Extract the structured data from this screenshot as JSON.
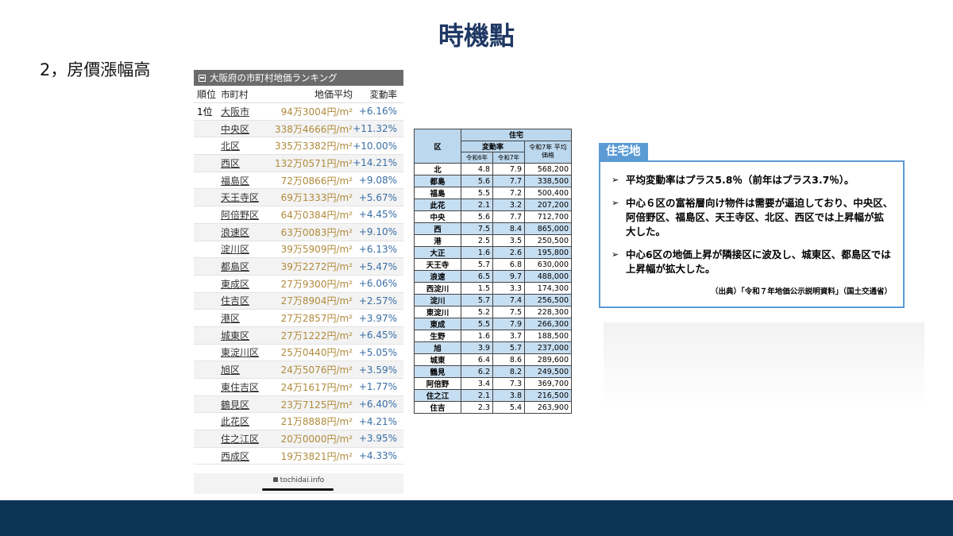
{
  "slide": {
    "title": "時機點",
    "point": "2，房價漲幅高"
  },
  "ranking": {
    "header": "大阪府の市町村地価ランキング",
    "columns": {
      "rank": "順位",
      "city": "市町村",
      "price": "地価平均",
      "change": "変動率"
    },
    "rows": [
      {
        "rank": "1位",
        "city": "大阪市",
        "price": "94万3004円/m²",
        "change": "+6.16%"
      },
      {
        "rank": "",
        "city": "中央区",
        "price": "338万4666円/m²",
        "change": "+11.32%"
      },
      {
        "rank": "",
        "city": "北区",
        "price": "335万3382円/m²",
        "change": "+10.00%"
      },
      {
        "rank": "",
        "city": "西区",
        "price": "132万0571円/m²",
        "change": "+14.21%"
      },
      {
        "rank": "",
        "city": "福島区",
        "price": "72万0866円/m²",
        "change": "+9.08%"
      },
      {
        "rank": "",
        "city": "天王寺区",
        "price": "69万1333円/m²",
        "change": "+5.67%"
      },
      {
        "rank": "",
        "city": "阿倍野区",
        "price": "64万0384円/m²",
        "change": "+4.45%"
      },
      {
        "rank": "",
        "city": "浪速区",
        "price": "63万0083円/m²",
        "change": "+9.10%"
      },
      {
        "rank": "",
        "city": "淀川区",
        "price": "39万5909円/m²",
        "change": "+6.13%"
      },
      {
        "rank": "",
        "city": "都島区",
        "price": "39万2272円/m²",
        "change": "+5.47%"
      },
      {
        "rank": "",
        "city": "東成区",
        "price": "27万9300円/m²",
        "change": "+6.06%"
      },
      {
        "rank": "",
        "city": "住吉区",
        "price": "27万8904円/m²",
        "change": "+2.57%"
      },
      {
        "rank": "",
        "city": "港区",
        "price": "27万2857円/m²",
        "change": "+3.97%"
      },
      {
        "rank": "",
        "city": "城東区",
        "price": "27万1222円/m²",
        "change": "+6.45%"
      },
      {
        "rank": "",
        "city": "東淀川区",
        "price": "25万0440円/m²",
        "change": "+5.05%"
      },
      {
        "rank": "",
        "city": "旭区",
        "price": "24万5076円/m²",
        "change": "+3.59%"
      },
      {
        "rank": "",
        "city": "東住吉区",
        "price": "24万1617円/m²",
        "change": "+1.77%"
      },
      {
        "rank": "",
        "city": "鶴見区",
        "price": "23万7125円/m²",
        "change": "+6.40%"
      },
      {
        "rank": "",
        "city": "此花区",
        "price": "21万8888円/m²",
        "change": "+4.21%"
      },
      {
        "rank": "",
        "city": "住之江区",
        "price": "20万0000円/m²",
        "change": "+3.95%"
      },
      {
        "rank": "",
        "city": "西成区",
        "price": "19万3821円/m²",
        "change": "+4.33%"
      }
    ],
    "footer_domain": "tochidai.info"
  },
  "ward_table": {
    "head_ward": "区",
    "head_group": "住宅",
    "head_change": "変動率",
    "head_r6": "令和6年",
    "head_r7": "令和7年",
    "head_price": "令和7年 平均価格",
    "rows": [
      {
        "ward": "北",
        "r6": "4.8",
        "r7": "7.9",
        "price": "568,200",
        "hl": false
      },
      {
        "ward": "都島",
        "r6": "5.6",
        "r7": "7.7",
        "price": "338,500",
        "hl": true
      },
      {
        "ward": "福島",
        "r6": "5.5",
        "r7": "7.2",
        "price": "500,400",
        "hl": false
      },
      {
        "ward": "此花",
        "r6": "2.1",
        "r7": "3.2",
        "price": "207,200",
        "hl": true
      },
      {
        "ward": "中央",
        "r6": "5.6",
        "r7": "7.7",
        "price": "712,700",
        "hl": false
      },
      {
        "ward": "西",
        "r6": "7.5",
        "r7": "8.4",
        "price": "865,000",
        "hl": true
      },
      {
        "ward": "港",
        "r6": "2.5",
        "r7": "3.5",
        "price": "250,500",
        "hl": false
      },
      {
        "ward": "大正",
        "r6": "1.6",
        "r7": "2.6",
        "price": "195,800",
        "hl": true
      },
      {
        "ward": "天王寺",
        "r6": "5.7",
        "r7": "6.8",
        "price": "630,000",
        "hl": false
      },
      {
        "ward": "浪速",
        "r6": "6.5",
        "r7": "9.7",
        "price": "488,000",
        "hl": true
      },
      {
        "ward": "西淀川",
        "r6": "1.5",
        "r7": "3.3",
        "price": "174,300",
        "hl": false
      },
      {
        "ward": "淀川",
        "r6": "5.7",
        "r7": "7.4",
        "price": "256,500",
        "hl": true
      },
      {
        "ward": "東淀川",
        "r6": "5.2",
        "r7": "7.5",
        "price": "228,300",
        "hl": false
      },
      {
        "ward": "東成",
        "r6": "5.5",
        "r7": "7.9",
        "price": "266,300",
        "hl": true
      },
      {
        "ward": "生野",
        "r6": "1.6",
        "r7": "3.7",
        "price": "188,500",
        "hl": false
      },
      {
        "ward": "旭",
        "r6": "3.9",
        "r7": "5.7",
        "price": "237,000",
        "hl": true
      },
      {
        "ward": "城東",
        "r6": "6.4",
        "r7": "8.6",
        "price": "289,600",
        "hl": false
      },
      {
        "ward": "鶴見",
        "r6": "6.2",
        "r7": "8.2",
        "price": "249,500",
        "hl": true
      },
      {
        "ward": "阿倍野",
        "r6": "3.4",
        "r7": "7.3",
        "price": "369,700",
        "hl": false
      },
      {
        "ward": "住之江",
        "r6": "2.1",
        "r7": "3.8",
        "price": "216,500",
        "hl": true
      },
      {
        "ward": "住吉",
        "r6": "2.3",
        "r7": "5.4",
        "price": "263,900",
        "hl": false
      }
    ]
  },
  "residential": {
    "tag": "住宅地",
    "bullets": [
      "平均変動率はプラス5.8％（前年はプラス3.7％）。",
      "中心６区の富裕層向け物件は需要が逼迫しており、中央区、阿倍野区、福島区、天王寺区、北区、西区では上昇幅が拡大した。",
      "中心6区の地価上昇が隣接区に波及し、城東区、都島区では上昇幅が拡大した。"
    ],
    "source": "（出典）「令和７年地価公示説明資料」（国土交通省）"
  },
  "colors": {
    "title": "#1f3864",
    "footer_band": "#0d3454",
    "accent_blue": "#5b9bd5",
    "table_highlight": "#c6def2",
    "price_gold": "#b08a3a",
    "change_blue": "#3a6ea5"
  }
}
